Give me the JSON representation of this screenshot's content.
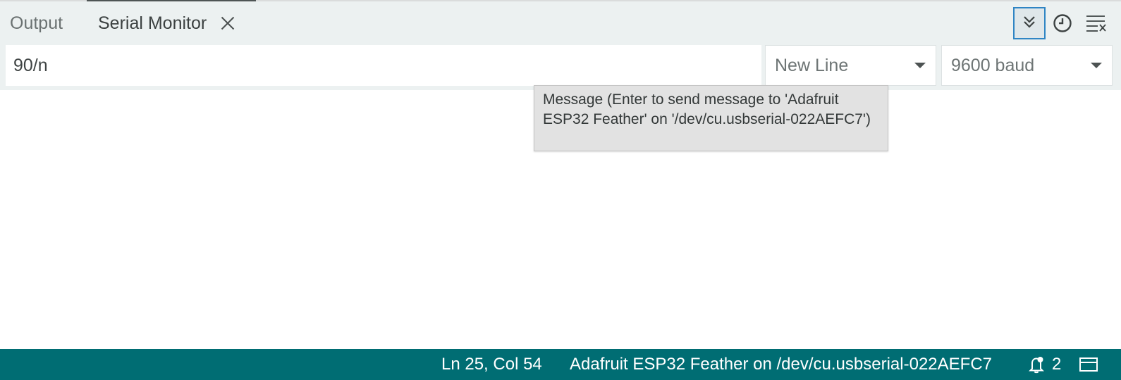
{
  "tabs": {
    "output_label": "Output",
    "serial_label": "Serial Monitor"
  },
  "actions": {
    "autoscroll_icon": "chevrons-down-icon",
    "timestamp_icon": "clock-icon",
    "clear_icon": "clear-output-icon"
  },
  "toolbar": {
    "message_value": "90/n",
    "line_ending": "New Line",
    "baud_rate": "9600 baud"
  },
  "tooltip": {
    "text": "Message (Enter to send message to 'Adafruit ESP32 Feather' on '/dev/cu.usbserial-022AEFC7')"
  },
  "status": {
    "position": "Ln 25, Col 54",
    "board": "Adafruit ESP32 Feather on /dev/cu.usbserial-022AEFC7",
    "notification_count": "2"
  },
  "colors": {
    "status_bar": "#006d73",
    "header_bg": "#ecf1f1",
    "focus_border": "#2f85c4"
  }
}
